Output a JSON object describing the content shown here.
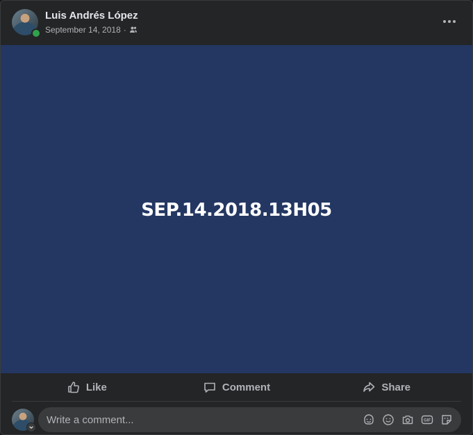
{
  "post": {
    "author": "Luis Andrés López",
    "date": "September 14, 2018",
    "separator": "·",
    "audience_icon": "friends-icon",
    "more_icon": "more-horizontal-icon",
    "background_color": "#233762",
    "text": "SEP.14.2018.13H05"
  },
  "actions": {
    "like_label": "Like",
    "comment_label": "Comment",
    "share_label": "Share"
  },
  "comment": {
    "placeholder": "Write a comment...",
    "tools": [
      "avatar-sticker-icon",
      "emoji-icon",
      "camera-icon",
      "gif-icon",
      "sticker-icon"
    ]
  },
  "colors": {
    "card_bg": "#242526",
    "online": "#31a24c",
    "muted_text": "#b0b3b8"
  }
}
